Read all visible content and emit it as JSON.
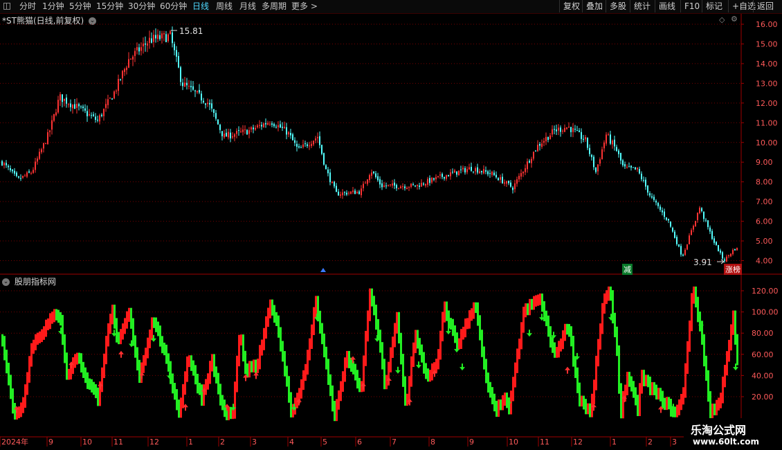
{
  "toolbar": {
    "periods": [
      "分时",
      "1分钟",
      "5分钟",
      "15分钟",
      "30分钟",
      "60分钟",
      "日线",
      "周线",
      "月线",
      "多周期",
      "更多 >"
    ],
    "active_period": "日线",
    "buttons": [
      "复权",
      "叠加",
      "多股",
      "统计",
      "画线",
      "F10",
      "标记",
      "+自选",
      "返回"
    ]
  },
  "main_chart": {
    "title": "*ST熊猫(日线,前复权)",
    "high_label": "15.81",
    "low_label": "3.91",
    "y_ticks": [
      "16.00",
      "15.00",
      "14.00",
      "13.00",
      "12.00",
      "11.00",
      "10.00",
      "9.00",
      "8.00",
      "7.00",
      "6.00",
      "5.00",
      "4.00"
    ],
    "tag_jian": "减",
    "tag_zhangting": "涨榜"
  },
  "indicator": {
    "title": "股朋指标网",
    "y_ticks": [
      "120.00",
      "100.00",
      "80.00",
      "60.00",
      "40.00",
      "20.00"
    ]
  },
  "x_axis": {
    "labels": [
      "2024年",
      "9",
      "10",
      "11",
      "12",
      "1",
      "2",
      "3",
      "4",
      "5",
      "6",
      "7",
      "8",
      "9",
      "10",
      "11",
      "12",
      "1",
      "2",
      "3"
    ]
  },
  "watermark": {
    "title": "乐淘公式网",
    "url": "www.60lt.com"
  },
  "colors": {
    "up": "#ff3333",
    "down": "#54ffff",
    "ind_up": "#ff1a1a",
    "ind_down": "#22ee22",
    "grid": "#7a0000",
    "axis_text": "#ff5a5a"
  },
  "chart_data": {
    "type": "candlestick",
    "price_series": [
      {
        "month": "2024-08",
        "close": 8.5
      },
      {
        "month": "2024-09",
        "close": 10.5
      },
      {
        "month": "2024-10",
        "close": 12.5
      },
      {
        "month": "2024-11",
        "close": 13.5
      },
      {
        "month": "2024-12",
        "close": 15.2
      },
      {
        "month": "2025-01",
        "close": 12.0
      },
      {
        "month": "2025-02",
        "close": 10.5
      },
      {
        "month": "2025-03",
        "close": 10.8
      },
      {
        "month": "2025-04",
        "close": 9.8
      },
      {
        "month": "2025-05",
        "close": 7.5
      },
      {
        "month": "2025-06",
        "close": 8.0
      },
      {
        "month": "2025-07",
        "close": 7.8
      },
      {
        "month": "2025-08",
        "close": 8.3
      },
      {
        "month": "2025-09",
        "close": 8.6
      },
      {
        "month": "2025-10",
        "close": 8.0
      },
      {
        "month": "2025-11",
        "close": 10.6
      },
      {
        "month": "2025-12",
        "close": 10.0
      },
      {
        "month": "2026-01",
        "close": 8.6
      },
      {
        "month": "2026-02",
        "close": 6.5
      },
      {
        "month": "2026-03",
        "close": 4.3
      }
    ],
    "price_ylim": [
      3.6,
      16.2
    ],
    "indicator_ylim": [
      0,
      125
    ]
  }
}
